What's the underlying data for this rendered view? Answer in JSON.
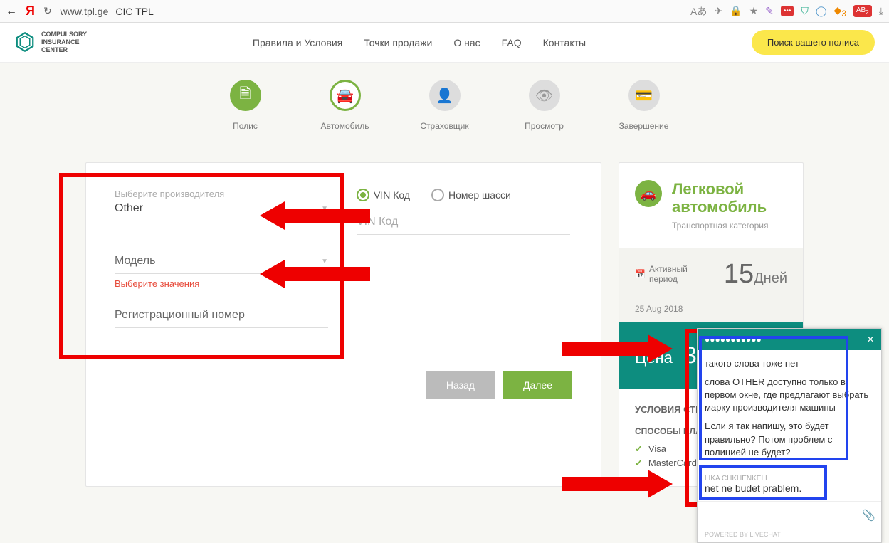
{
  "browser": {
    "url": "www.tpl.ge",
    "page_title": "CIC TPL",
    "translate_badge": "Аあ",
    "badge_red": "•••",
    "badge_count": "3",
    "badge_ab": "AB",
    "badge_ab_count": "2"
  },
  "logo": {
    "line1": "COMPULSORY",
    "line2": "INSURANCE",
    "line3": "CENTER"
  },
  "nav": {
    "rules": "Правила и Условия",
    "points": "Точки продажи",
    "about": "О нас",
    "faq": "FAQ",
    "contacts": "Контакты"
  },
  "search_btn": "Поиск вашего полиса",
  "steps": {
    "policy": "Полис",
    "car": "Автомобиль",
    "insurer": "Страховщик",
    "review": "Просмотр",
    "complete": "Завершение"
  },
  "form": {
    "maker_label": "Выберите производителя",
    "maker_value": "Other",
    "radio_vin": "VIN Код",
    "radio_chassis": "Номер шасси",
    "vin_label": "VIN Код",
    "model_label": "Модель",
    "model_value": "",
    "model_error": "Выберите значения",
    "reg_label": "Регистрационный номер",
    "btn_back": "Назад",
    "btn_next": "Далее"
  },
  "sidebar": {
    "cat_title": "Легковой автомобиль",
    "cat_sub": "Транспортная категория",
    "period_label": "Активный период",
    "period_num": "15",
    "period_unit": "Дней",
    "period_date": "25 Aug 2018",
    "price_label": "Цена",
    "price_value": "3",
    "cond_title": "УСЛОВИЯ СТРАХ",
    "pay_title": "СПОСОБЫ ПЛАТ",
    "pay_visa": "Visa",
    "pay_mc": "MasterCard"
  },
  "chat": {
    "msg1": "такого слова тоже нет",
    "msg2": "слова OTHER доступно только в первом окне, где предлагают выбрать марку производителя машины",
    "msg3": "Если я так напишу, это будет правильно? Потом проблем с полицией не будет?",
    "agent": "LIKA CHKHENKELI",
    "reply": "net ne budet prablem.",
    "footer": "POWERED BY LIVECHAT"
  }
}
